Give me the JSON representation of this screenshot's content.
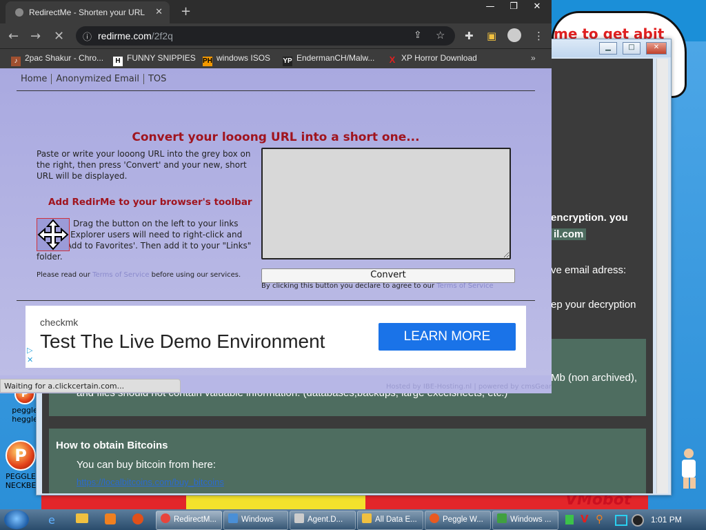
{
  "browser": {
    "tab_title": "RedirectMe - Shorten your URL",
    "tab_close": "✕",
    "window_controls": [
      "—",
      "❐",
      "✕"
    ],
    "url_host": "redirme.com",
    "url_path": "/2f2q",
    "bookmarks": [
      {
        "label": "2pac Shakur - Chro...",
        "icon": "music-icon"
      },
      {
        "label": "FUNNY SNIPPIES",
        "icon": "H"
      },
      {
        "label": "windows ISOS",
        "icon": "PH"
      },
      {
        "label": "EndermanCH/Malw...",
        "icon": "YP"
      },
      {
        "label": "XP Horror Download",
        "icon": "X"
      }
    ],
    "bookmarks_more": "»",
    "status": "Waiting for a.clickcertain.com..."
  },
  "site": {
    "nav": [
      "Home",
      "Anonymized Email",
      "TOS"
    ],
    "headline": "Convert your looong URL into a short one...",
    "intro": "Paste or write your looong URL into the grey box on the right, then press 'Convert' and your new, short URL will be displayed.",
    "toolbar_heading": "Add RedirMe to your browser's toolbar",
    "drag_text": "Drag the button on the left to your links toolbar. Explorer users will need to right-click and select 'Add to Favorites'. Then add it to your \"Links\" folder.",
    "read_note_pre": "Please read our ",
    "read_note_link": "Terms of Service",
    "read_note_post": " before using our services.",
    "url_value": "",
    "convert_label": "Convert",
    "agree_pre": "By clicking this button you declare to agree to our ",
    "agree_link": "Terms of Service",
    "footer_hosted": "Hosted by IBE-Hosting.nl",
    "footer_powered": "| powered by cmsGear"
  },
  "ad": {
    "brand": "checkmk",
    "headline": "Test The Live Demo Environment",
    "cta": "LEARN MORE"
  },
  "background_window": {
    "lines": [
      "encryption. you",
      "il.com",
      "ve email adress:",
      "ep your decryption",
      "Mb (non archived),",
      "and files should not contain valuable information. (databases,backups, large excelsheets, etc.)",
      "How to obtain Bitcoins",
      "You can buy bitcoin from here:",
      "https://localbitcoins.com/buy_bitcoins"
    ],
    "title_fragment": "me to get abit"
  },
  "desktop": {
    "icons": [
      {
        "label": "peggle",
        "label2": "heggle"
      },
      {
        "label": "PEGGLE",
        "label2": "NECKBE"
      }
    ],
    "banner_text": "VMobot"
  },
  "taskbar": {
    "items": [
      {
        "label": "RedirectM...",
        "color": "#e8453c"
      },
      {
        "label": "Windows",
        "color": "#4a8fd6"
      },
      {
        "label": "Agent.D...",
        "color": "#cccccc"
      },
      {
        "label": "All Data E...",
        "color": "#f0c040"
      },
      {
        "label": "Peggle W...",
        "color": "#e85a20"
      },
      {
        "label": "Windows ...",
        "color": "#40a040"
      }
    ],
    "clock": "1:01 PM"
  }
}
